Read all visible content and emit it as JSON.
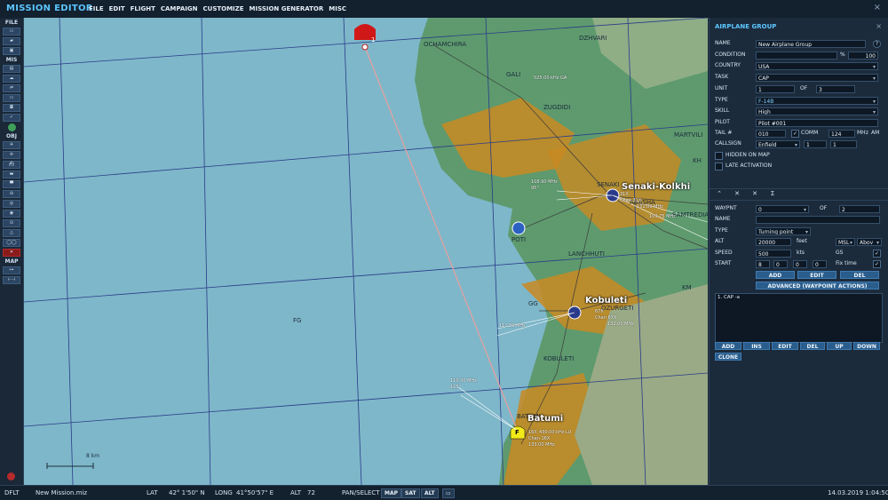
{
  "app": {
    "title": "MISSION EDITOR",
    "close_glyph": "×"
  },
  "menu": [
    "FILE",
    "EDIT",
    "FLIGHT",
    "CAMPAIGN",
    "CUSTOMIZE",
    "MISSION GENERATOR",
    "MISC"
  ],
  "toolbar": {
    "file_label": "FILE",
    "mis_label": "MIS",
    "obj_label": "OBJ",
    "map_label": "MAP"
  },
  "map": {
    "places": [
      "OCHAMCHIRA",
      "DZHVARI",
      "GALI",
      "ZUGDIDI",
      "MARTVILI",
      "SENAKI",
      "ABASHA",
      "SAMTREDIA",
      "POTI",
      "LANCHHUTI",
      "KOBULETI",
      "OZURGETI",
      "BATUMI",
      "FG",
      "GG",
      "KM",
      "KH"
    ],
    "cities": [
      "Senaki-Kolkhi",
      "Kobuleti",
      "Batumi"
    ],
    "freqs": [
      "108.90 MHz",
      "95°",
      "109.75 MHz",
      "111.50 MHz",
      "110.30 MHz",
      "125°"
    ],
    "airfield_info": [
      "31X",
      "Chan 31X",
      "67X",
      "Chan 67X",
      "16X",
      "Chan 16X",
      "131.00 MHz",
      "132.00 MHz",
      "133.00 MHz"
    ],
    "scale_label": "8 km",
    "waypoint_index": "1",
    "ndb_label": "525.00 kHz GA",
    "ndb_batumi": "430.00 kHz LU",
    "batumi_letter": "F"
  },
  "panel": {
    "title": "AIRPLANE GROUP",
    "name_label": "NAME",
    "name_value": "New Airplane Group",
    "help": "?",
    "condition_label": "CONDITION",
    "condition_pct": "%",
    "condition_value": "100",
    "country_label": "COUNTRY",
    "country_value": "USA",
    "task_label": "TASK",
    "task_value": "CAP",
    "unit_label": "UNIT",
    "unit_value": "1",
    "unit_of": "OF",
    "unit_total": "3",
    "type_label": "TYPE",
    "type_value": "F-14B",
    "skill_label": "SKILL",
    "skill_value": "High",
    "pilot_label": "PILOT",
    "pilot_value": "Pilot #001",
    "tail_label": "TAIL #",
    "tail_value": "010",
    "comm_label": "COMM",
    "comm_value": "124",
    "mhz": "MHz",
    "am": "AM",
    "callsign_label": "CALLSIGN",
    "callsign_value": "Enfield",
    "callsign_n1": "1",
    "callsign_n2": "1",
    "hidden_label": "HIDDEN ON MAP",
    "late_label": "LATE ACTIVATION",
    "tabs": [
      "⌃",
      "✕",
      "✕",
      "Σ"
    ],
    "wp_label": "WAYPNT",
    "wp_value": "0",
    "wp_of": "OF",
    "wp_total": "2",
    "wp_name_label": "NAME",
    "wp_type_label": "TYPE",
    "wp_type_value": "Turning point",
    "alt_label": "ALT",
    "alt_value": "20000",
    "alt_unit": "feet",
    "alt_ref": "MSL",
    "alt_ref2": "Abov",
    "speed_label": "SPEED",
    "speed_value": "500",
    "speed_unit": "kts",
    "gs_label": "GS",
    "start_label": "START",
    "start_d": "8",
    "start_h": "0",
    "start_m": "0",
    "start_s": "0",
    "fix_label": "Fix time",
    "add_label": "ADD",
    "edit_label": "EDIT",
    "del_label": "DEL",
    "advanced_label": "ADVANCED (WAYPOINT ACTIONS)",
    "actions": [
      "1. CAP -a"
    ],
    "action_buttons": [
      "ADD",
      "INS",
      "EDIT",
      "DEL",
      "UP",
      "DOWN"
    ],
    "clone_label": "CLONE",
    "check_glyph": "✓"
  },
  "status": {
    "mode": "DFLT",
    "file": "New Mission.miz",
    "lat_label": "LAT",
    "lat_value": "42° 1'50\" N",
    "long_label": "LONG",
    "long_value": "41°50'57\" E",
    "alt_label": "ALT",
    "alt_value": "72",
    "pan_label": "PAN/SELECT",
    "map_btn": "MAP",
    "sat_btn": "SAT",
    "alt_btn": "ALT",
    "datetime": "14.03.2019 1:04:50"
  },
  "colors": {
    "accent": "#5cc6ff",
    "sea": "#7eb7c9",
    "land": "#5e9a6e",
    "sand": "#c98a22",
    "route": "#e9a0a0",
    "enemy": "#d01818",
    "batumi_marker": "#f2ea1a"
  }
}
